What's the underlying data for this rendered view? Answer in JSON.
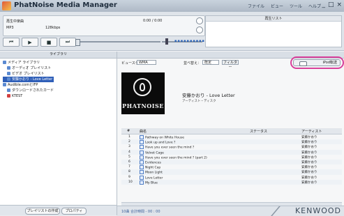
{
  "window": {
    "title": "PhatNoise Media Manager",
    "menu": [
      "ファイル",
      "ビュー",
      "ツール",
      "ヘルプ"
    ],
    "buttons": [
      "_",
      "□",
      "×"
    ]
  },
  "player": {
    "now_title": "再生中楽曲",
    "format": "MP3",
    "bitrate": "128kbps",
    "time": "0:00 / 0:00",
    "controls": [
      "⏮",
      "▶",
      "■",
      "⏭"
    ],
    "lyrics_header": "再生リスト"
  },
  "library": {
    "header": "ライブラリ",
    "tree": [
      {
        "label": "メディア ライブラリ",
        "level": 0,
        "selected": false,
        "red": false
      },
      {
        "label": "オーディオ プレイリスト",
        "level": 1,
        "selected": false,
        "red": false
      },
      {
        "label": "ビデオ プレイリスト",
        "level": 1,
        "selected": false,
        "red": false
      },
      {
        "label": "安藤かおり - Love Letter",
        "level": 1,
        "selected": true,
        "red": false
      },
      {
        "label": "Audible.comとIFP",
        "level": 0,
        "selected": false,
        "red": false
      },
      {
        "label": "ダウンロードされたカード",
        "level": 1,
        "selected": false,
        "red": false
      },
      {
        "label": "KTEST",
        "level": 1,
        "selected": false,
        "red": true
      }
    ],
    "buttons": [
      "プレイリストの作成",
      "プロパティ"
    ]
  },
  "toolbar": {
    "view_label": "ビュースタイル",
    "view_value": "WMA",
    "filter_label": "並べ替え：",
    "filter_value": "既定",
    "filter_button": "フィルター",
    "sync_button": "iPod転送"
  },
  "album": {
    "brand": "PHATNOISE",
    "title": "安藤かおり - Love Letter",
    "subtitle": "アーティスト・ディスク"
  },
  "table": {
    "headers": [
      "#",
      "曲名",
      "ステータス",
      "アーティスト"
    ],
    "rows": [
      {
        "num": "1",
        "title": "Pathway on White House",
        "artist": "安藤かおり"
      },
      {
        "num": "2",
        "title": "Look up and Love ?",
        "artist": "安藤かおり"
      },
      {
        "num": "3",
        "title": "Have you ever seen the mind ?",
        "artist": "安藤かおり"
      },
      {
        "num": "4",
        "title": "Velvet Cage",
        "artist": "安藤かおり"
      },
      {
        "num": "5",
        "title": "Have you ever seen the mind ? (part 2)",
        "artist": "安藤かおり"
      },
      {
        "num": "6",
        "title": "Evidences",
        "artist": "安藤かおり"
      },
      {
        "num": "7",
        "title": "Night Cap",
        "artist": "安藤かおり"
      },
      {
        "num": "8",
        "title": "Moon Light",
        "artist": "安藤かおり"
      },
      {
        "num": "9",
        "title": "Love Letter",
        "artist": "安藤かおり"
      },
      {
        "num": "10",
        "title": "My Blue",
        "artist": "安藤かおり"
      }
    ]
  },
  "status": {
    "text": "10曲  合計時間 - 00 : 00",
    "logo": "KENWOOD"
  },
  "colors": {
    "accent": "#2f5fb8",
    "highlight_ring": "#d8409b"
  }
}
